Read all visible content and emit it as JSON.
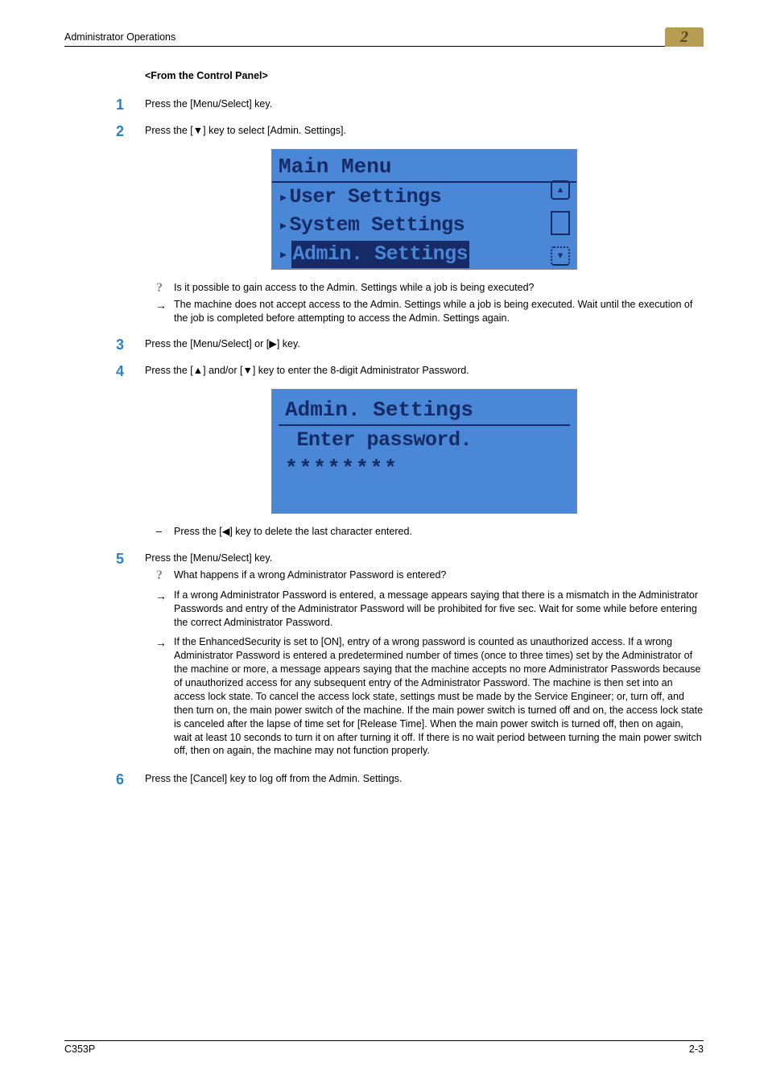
{
  "header": {
    "title": "Administrator Operations",
    "tabnum": "2"
  },
  "section_head": "<From the Control Panel>",
  "steps": {
    "s1": {
      "num": "1",
      "text": "Press the [Menu/Select] key."
    },
    "s2": {
      "num": "2",
      "text": "Press the [▼] key to select [Admin. Settings]."
    },
    "s3": {
      "num": "3",
      "text": "Press the [Menu/Select] or [▶] key."
    },
    "s4": {
      "num": "4",
      "text": "Press the [▲] and/or [▼] key to enter the 8-digit Administrator Password."
    },
    "s5": {
      "num": "5",
      "text": "Press the [Menu/Select] key."
    },
    "s6": {
      "num": "6",
      "text": "Press the [Cancel] key to log off from the Admin. Settings."
    }
  },
  "lcd1": {
    "title": "Main Menu",
    "row1": "User Settings",
    "row2": "System Settings",
    "row3": "Admin. Settings"
  },
  "lcd2": {
    "title": "Admin. Settings",
    "row1": " Enter password.",
    "stars": "********"
  },
  "qna1": {
    "q": "Is it possible to gain access to the Admin. Settings while a job is being executed?",
    "a": "The machine does not accept access to the Admin. Settings while a job is being executed. Wait until the execution of the job is completed before attempting to access the Admin. Settings again."
  },
  "sub_s4": "Press the [◀] key to delete the last character entered.",
  "qna2": {
    "q": "What happens if a wrong Administrator Password is entered?",
    "a1": "If a wrong Administrator Password is entered, a message appears saying that there is a mismatch in the Administrator Passwords and entry of the Administrator Password will be prohibited for five sec. Wait for some while before entering the correct Administrator Password.",
    "a2": "If the EnhancedSecurity is set to [ON], entry of a wrong password is counted as unauthorized access. If a wrong Administrator Password is entered a predetermined number of times (once to three times) set by the Administrator of the machine or more, a message appears saying that the machine accepts no more Administrator Passwords because of unauthorized access for any subsequent entry of the Administrator Password. The machine is then set into an access lock state. To cancel the access lock state, settings must be made by the Service Engineer; or, turn off, and then turn on, the main power switch of the machine. If the main power switch is turned off and on, the access lock state is canceled after the lapse of time set for [Release Time]. When the main power switch is turned off, then on again, wait at least 10 seconds to turn it on after turning it off. If there is no wait period between turning the main power switch off, then on again, the machine may not function properly."
  },
  "footer": {
    "left": "C353P",
    "right": "2-3"
  }
}
